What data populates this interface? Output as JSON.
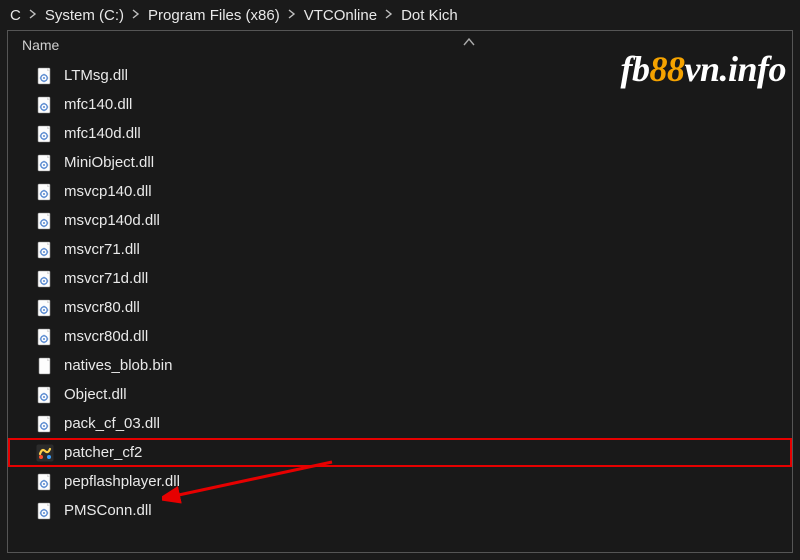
{
  "breadcrumb": {
    "items": [
      "C",
      "System (C:)",
      "Program Files (x86)",
      "VTCOnline",
      "Dot Kich"
    ]
  },
  "columns": {
    "name": "Name"
  },
  "files": [
    {
      "name": "LTMsg.dll",
      "icon": "dll",
      "highlighted": false
    },
    {
      "name": "mfc140.dll",
      "icon": "dll",
      "highlighted": false
    },
    {
      "name": "mfc140d.dll",
      "icon": "dll",
      "highlighted": false
    },
    {
      "name": "MiniObject.dll",
      "icon": "dll",
      "highlighted": false
    },
    {
      "name": "msvcp140.dll",
      "icon": "dll",
      "highlighted": false
    },
    {
      "name": "msvcp140d.dll",
      "icon": "dll",
      "highlighted": false
    },
    {
      "name": "msvcr71.dll",
      "icon": "dll",
      "highlighted": false
    },
    {
      "name": "msvcr71d.dll",
      "icon": "dll",
      "highlighted": false
    },
    {
      "name": "msvcr80.dll",
      "icon": "dll",
      "highlighted": false
    },
    {
      "name": "msvcr80d.dll",
      "icon": "dll",
      "highlighted": false
    },
    {
      "name": "natives_blob.bin",
      "icon": "file",
      "highlighted": false
    },
    {
      "name": "Object.dll",
      "icon": "dll",
      "highlighted": false
    },
    {
      "name": "pack_cf_03.dll",
      "icon": "dll",
      "highlighted": false
    },
    {
      "name": "patcher_cf2",
      "icon": "exe",
      "highlighted": true
    },
    {
      "name": "pepflashplayer.dll",
      "icon": "dll",
      "highlighted": false
    },
    {
      "name": "PMSConn.dll",
      "icon": "dll",
      "highlighted": false
    }
  ],
  "watermark": {
    "part1": "fb",
    "part2": "88",
    "part3": "vn.info"
  },
  "annotation": {
    "arrow_color": "#e60000",
    "highlight_color": "#e60000"
  }
}
